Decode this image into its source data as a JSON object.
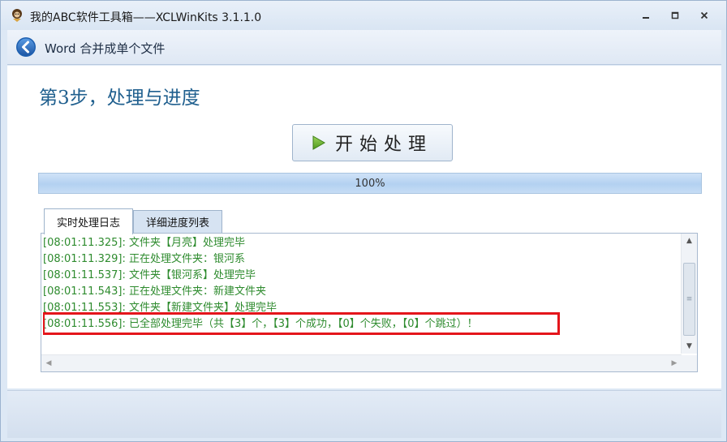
{
  "window": {
    "title": "我的ABC软件工具箱——XCLWinKits  3.1.1.0"
  },
  "nav": {
    "title": "Word 合并成单个文件"
  },
  "step": {
    "title": "第3步，处理与进度"
  },
  "start_button": {
    "label": "开始处理"
  },
  "progress": {
    "value": 100,
    "label": "100%"
  },
  "tabs": [
    {
      "label": "实时处理日志",
      "active": true
    },
    {
      "label": "详细进度列表",
      "active": false
    }
  ],
  "log": {
    "lines": [
      "[08:01:11.325]: 文件夹【月亮】处理完毕",
      "[08:01:11.329]: 正在处理文件夹：银河系",
      "[08:01:11.537]: 文件夹【银河系】处理完毕",
      "[08:01:11.543]: 正在处理文件夹：新建文件夹",
      "[08:01:11.553]: 文件夹【新建文件夹】处理完毕",
      "[08:01:11.556]: 已全部处理完毕（共【3】个，【3】个成功，【0】个失败，【0】个跳过）！"
    ],
    "text_color": "#2e8b2e",
    "highlight_color": "#e4151b"
  },
  "icons": {
    "app": "monkey-icon",
    "back": "back-arrow-icon",
    "play": "play-icon"
  }
}
